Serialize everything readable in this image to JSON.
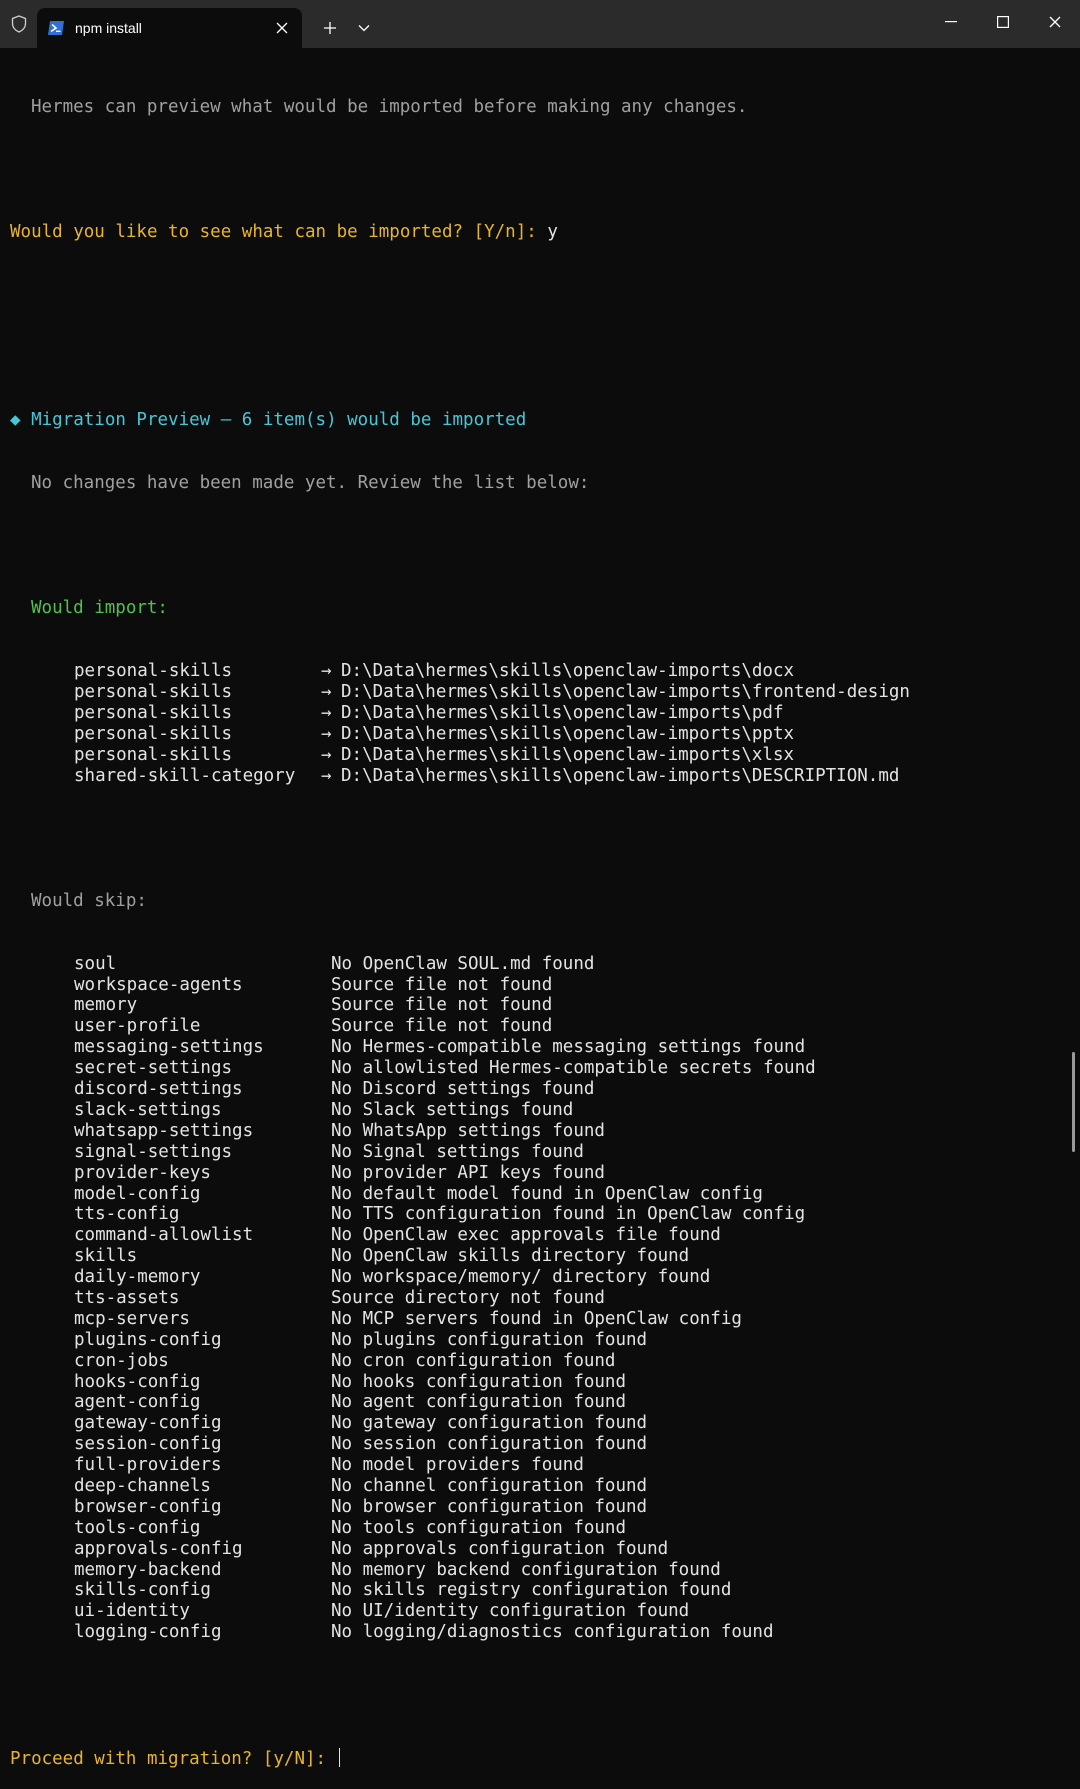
{
  "window": {
    "tab_title": "npm install",
    "shield_icon": "shield-icon",
    "tab_icon": "powershell-icon",
    "new_tab_glyph": "+",
    "dropdown_glyph": "⌄",
    "min_glyph": "—",
    "max_glyph": "☐",
    "close_glyph": "✕"
  },
  "colors": {
    "background": "#0c0c0c",
    "prompt_yellow": "#e8b42a",
    "heading_cyan": "#44c8d8",
    "import_green": "#4ec24e",
    "dim_gray": "#a0a0a0"
  },
  "terminal": {
    "line_preview": "Hermes can preview what would be imported before making any changes.",
    "prompt_see": "Would you like to see what can be imported? [Y/n]: ",
    "answer_see": "y",
    "preview_heading": "◆ Migration Preview — 6 item(s) would be imported",
    "preview_sub": "No changes have been made yet. Review the list below:",
    "import_heading": "Would import:",
    "arrow": "→",
    "imports": [
      {
        "name": "personal-skills",
        "path": "D:\\Data\\hermes\\skills\\openclaw-imports\\docx"
      },
      {
        "name": "personal-skills",
        "path": "D:\\Data\\hermes\\skills\\openclaw-imports\\frontend-design"
      },
      {
        "name": "personal-skills",
        "path": "D:\\Data\\hermes\\skills\\openclaw-imports\\pdf"
      },
      {
        "name": "personal-skills",
        "path": "D:\\Data\\hermes\\skills\\openclaw-imports\\pptx"
      },
      {
        "name": "personal-skills",
        "path": "D:\\Data\\hermes\\skills\\openclaw-imports\\xlsx"
      },
      {
        "name": "shared-skill-category",
        "path": "D:\\Data\\hermes\\skills\\openclaw-imports\\DESCRIPTION.md"
      }
    ],
    "skip_heading": "Would skip:",
    "skips": [
      {
        "name": "soul",
        "reason": "No OpenClaw SOUL.md found"
      },
      {
        "name": "workspace-agents",
        "reason": "Source file not found"
      },
      {
        "name": "memory",
        "reason": "Source file not found"
      },
      {
        "name": "user-profile",
        "reason": "Source file not found"
      },
      {
        "name": "messaging-settings",
        "reason": "No Hermes-compatible messaging settings found"
      },
      {
        "name": "secret-settings",
        "reason": "No allowlisted Hermes-compatible secrets found"
      },
      {
        "name": "discord-settings",
        "reason": "No Discord settings found"
      },
      {
        "name": "slack-settings",
        "reason": "No Slack settings found"
      },
      {
        "name": "whatsapp-settings",
        "reason": "No WhatsApp settings found"
      },
      {
        "name": "signal-settings",
        "reason": "No Signal settings found"
      },
      {
        "name": "provider-keys",
        "reason": "No provider API keys found"
      },
      {
        "name": "model-config",
        "reason": "No default model found in OpenClaw config"
      },
      {
        "name": "tts-config",
        "reason": "No TTS configuration found in OpenClaw config"
      },
      {
        "name": "command-allowlist",
        "reason": "No OpenClaw exec approvals file found"
      },
      {
        "name": "skills",
        "reason": "No OpenClaw skills directory found"
      },
      {
        "name": "daily-memory",
        "reason": "No workspace/memory/ directory found"
      },
      {
        "name": "tts-assets",
        "reason": "Source directory not found"
      },
      {
        "name": "mcp-servers",
        "reason": "No MCP servers found in OpenClaw config"
      },
      {
        "name": "plugins-config",
        "reason": "No plugins configuration found"
      },
      {
        "name": "cron-jobs",
        "reason": "No cron configuration found"
      },
      {
        "name": "hooks-config",
        "reason": "No hooks configuration found"
      },
      {
        "name": "agent-config",
        "reason": "No agent configuration found"
      },
      {
        "name": "gateway-config",
        "reason": "No gateway configuration found"
      },
      {
        "name": "session-config",
        "reason": "No session configuration found"
      },
      {
        "name": "full-providers",
        "reason": "No model providers found"
      },
      {
        "name": "deep-channels",
        "reason": "No channel configuration found"
      },
      {
        "name": "browser-config",
        "reason": "No browser configuration found"
      },
      {
        "name": "tools-config",
        "reason": "No tools configuration found"
      },
      {
        "name": "approvals-config",
        "reason": "No approvals configuration found"
      },
      {
        "name": "memory-backend",
        "reason": "No memory backend configuration found"
      },
      {
        "name": "skills-config",
        "reason": "No skills registry configuration found"
      },
      {
        "name": "ui-identity",
        "reason": "No UI/identity configuration found"
      },
      {
        "name": "logging-config",
        "reason": "No logging/diagnostics configuration found"
      }
    ],
    "prompt_proceed": "Proceed with migration? [y/N]: "
  }
}
